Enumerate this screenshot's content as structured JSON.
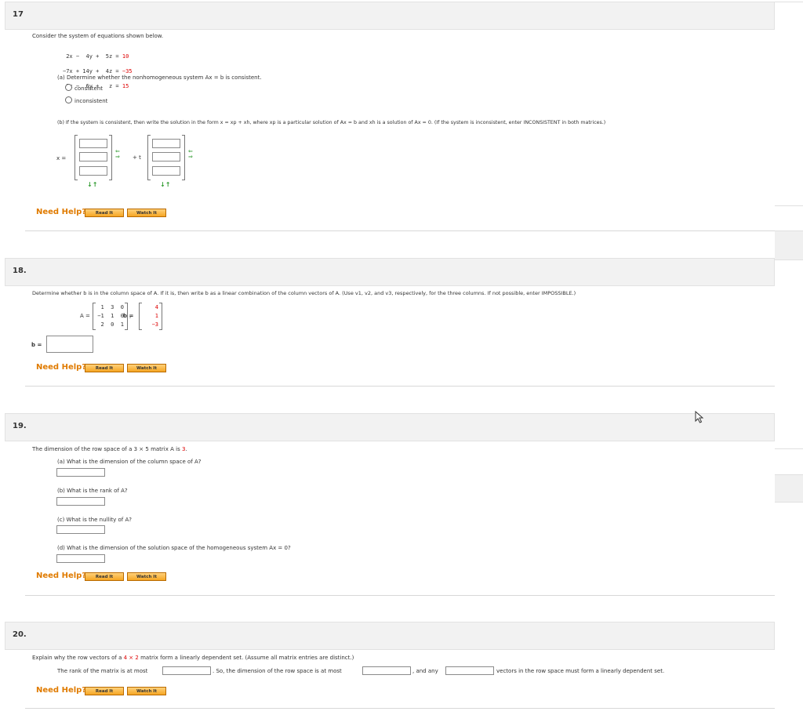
{
  "q17": {
    "number": "17",
    "prompt": "Consider the system of equations shown below.",
    "equations": [
      {
        "lhs": " 2x −  4y +  5z = ",
        "rhs": "10"
      },
      {
        "lhs": "−7x + 14y +  4z = ",
        "rhs": "−35"
      },
      {
        "lhs": " 3x −  6y +   z = ",
        "rhs": "15"
      }
    ],
    "part_a": "(a) Determine whether the nonhomogeneous system Ax = b is consistent.",
    "options": [
      "consistent",
      "inconsistent"
    ],
    "part_b": "(b) If the system is consistent, then write the solution in the form x = xp + xh, where xp is a particular solution of Ax = b and xh is a solution of Ax = 0. (If the system is inconsistent, enter INCONSISTENT in both matrices.)",
    "x_label": "x =",
    "plus_t": "+ t"
  },
  "q18": {
    "number": "18.",
    "prompt": "Determine whether b is in the column space of A. If it is, then write b as a linear combination of the column vectors of A. (Use v1, v2, and v3, respectively, for the three columns. If not possible, enter IMPOSSIBLE.)",
    "A_label": "A =",
    "A_rows": [
      "1  3  0",
      "−1  1  0",
      "2  0  1"
    ],
    "b_label": "b =",
    "b_values": [
      "4",
      "1",
      "−3"
    ],
    "answer_label": "b ="
  },
  "q19": {
    "number": "19.",
    "prompt_pre": "The dimension of the row space of a 3 × 5 matrix A is ",
    "prompt_value": "3",
    "prompt_post": ".",
    "parts": [
      "(a) What is the dimension of the column space of A?",
      "(b) What is the rank of A?",
      "(c) What is the nullity of A?",
      "(d) What is the dimension of the solution space of the homogeneous system Ax = 0?"
    ]
  },
  "q20": {
    "number": "20.",
    "prompt_pre": "Explain why the row vectors of a ",
    "prompt_dims": "4 × 2",
    "prompt_post": " matrix form a linearly dependent set. (Assume all matrix entries are distinct.)",
    "text1": "The rank of the matrix is at most",
    "text2": ". So, the dimension of the row space is at most",
    "text3": ", and any",
    "text4": "vectors in the row space must form a linearly dependent set."
  },
  "help": {
    "label": "Need Help?",
    "read": "Read It",
    "watch": "Watch It"
  },
  "colors": {
    "help_orange": "#e07b00",
    "button_fill": "#f5a623",
    "value_red": "#dd0000",
    "arrow_green": "#2e9a2e"
  }
}
